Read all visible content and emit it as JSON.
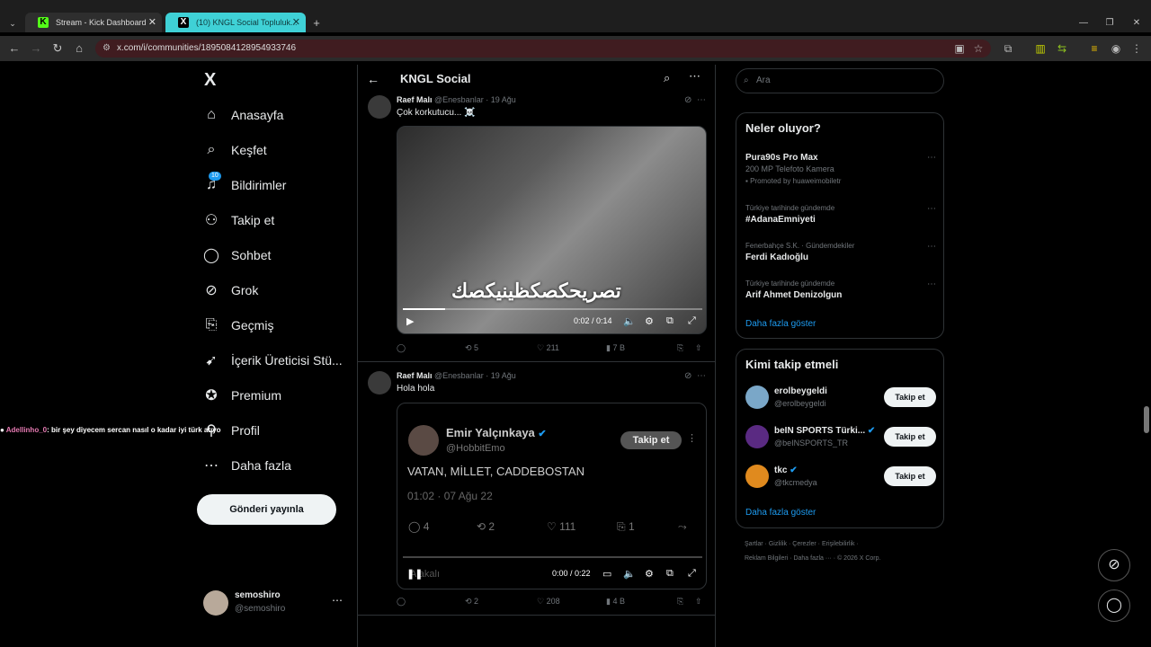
{
  "browser": {
    "tabs": [
      {
        "title": "Stream - Kick Dashboard",
        "favicon": "K"
      },
      {
        "title": "(10) KNGL Social Topluluk...",
        "favicon": "X"
      }
    ],
    "url": "x.com/i/communities/1895084128954933746"
  },
  "left_nav": {
    "logo": "X",
    "items": [
      {
        "label": "Anasayfa",
        "icon": "⌂"
      },
      {
        "label": "Keşfet",
        "icon": "⌕"
      },
      {
        "label": "Bildirimler",
        "icon": "♫",
        "badge": "10"
      },
      {
        "label": "Takip et",
        "icon": "⚇"
      },
      {
        "label": "Sohbet",
        "icon": "◯"
      },
      {
        "label": "Grok",
        "icon": "⊘"
      },
      {
        "label": "Geçmiş",
        "icon": "⎘"
      },
      {
        "label": "İçerik Üreticisi Stü...",
        "icon": "➹"
      },
      {
        "label": "Premium",
        "icon": "✪"
      },
      {
        "label": "Profil",
        "icon": "⚲"
      },
      {
        "label": "Daha fazla",
        "icon": "⋯"
      }
    ],
    "post_button": "Gönderi yayınla",
    "account": {
      "name": "semoshiro",
      "handle": "@semoshiro"
    }
  },
  "overlay_chat": {
    "user": "Adellinho_0",
    "message": ": bir şey diyecem sercan nasıl o kadar iyi türk atıyo"
  },
  "center": {
    "title": "KNGL Social",
    "tweets": [
      {
        "name": "Raef Malı",
        "handle": "@Enesbanlar",
        "date": "· 19 Ağu",
        "text": "Çok korkutucu... ☠️",
        "video": {
          "overlay_text": "تصريحکصکظینیکصك",
          "time": "0:02 / 0:14",
          "progress": 0.14
        },
        "stats": {
          "reply": "",
          "retweet": "5",
          "like": "211",
          "views": "7 B"
        }
      },
      {
        "name": "Raef Malı",
        "handle": "@Enesbanlar",
        "date": "· 19 Ağu",
        "text": "Hola hola",
        "quote": {
          "name": "Emir Yalçınkaya",
          "handle": "@HobbitEmo",
          "follow": "Takip et",
          "text": "VATAN, MİLLET, CADDEBOSTAN",
          "date": "01:02 · 07 Ağu 22",
          "stats": {
            "reply": "4",
            "retweet": "2",
            "like": "111",
            "bookmark": "1"
          },
          "ghost_text": "Alakalı",
          "time": "0:00 / 0:22"
        },
        "stats": {
          "reply": "",
          "retweet": "2",
          "like": "208",
          "views": "4 B"
        }
      }
    ]
  },
  "right": {
    "search_placeholder": "Ara",
    "trends_title": "Neler oluyor?",
    "trends": [
      {
        "context": "",
        "name": "Pura90s Pro Max",
        "sub": "200 MP Telefoto Kamera",
        "promo": "Promoted by huaweimobiletr"
      },
      {
        "context": "Türkiye tarihinde gündemde",
        "name": "#AdanaEmniyeti"
      },
      {
        "context": "Fenerbahçe S.K. · Gündemdekiler",
        "name": "Ferdi Kadıoğlu"
      },
      {
        "context": "Türkiye tarihinde gündemde",
        "name": "Arif Ahmet Denizolgun"
      }
    ],
    "show_more": "Daha fazla göster",
    "who_title": "Kimi takip etmeli",
    "who": [
      {
        "name": "erolbeygeldi",
        "handle": "@erolbeygeldi",
        "color": "#7aa7c8"
      },
      {
        "name": "beIN SPORTS Türki...",
        "handle": "@beINSPORTS_TR",
        "color": "#5a2a82"
      },
      {
        "name": "tkc",
        "handle": "@tkcmedya",
        "color": "#e08a1e"
      }
    ],
    "follow_label": "Takip et",
    "footer1": "Şartlar · Gizlilik · Çerezler · Erişilebilirlik ·",
    "footer2": "Reklam Bilgileri · Daha fazla ··· · © 2026 X Corp."
  }
}
